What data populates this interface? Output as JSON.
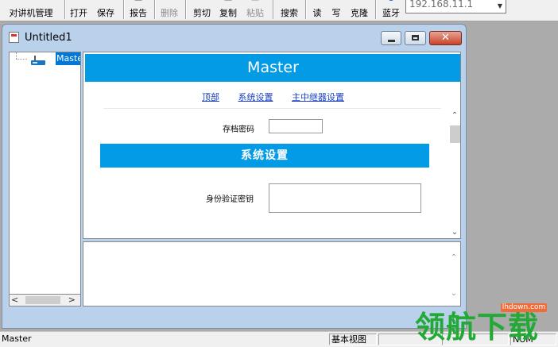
{
  "toolbar": {
    "buttons": [
      {
        "label": "对讲机管理"
      },
      {
        "label": "打开"
      },
      {
        "label": "保存"
      },
      {
        "label": "报告"
      },
      {
        "label": "删除"
      },
      {
        "label": "剪切"
      },
      {
        "label": "复制"
      },
      {
        "label": "粘贴"
      },
      {
        "label": "搜索"
      },
      {
        "label": "读"
      },
      {
        "label": "写"
      },
      {
        "label": "克隆"
      },
      {
        "label": "蓝牙"
      }
    ],
    "ip_value": "192.168.11.1"
  },
  "child_window": {
    "title": "Untitled1",
    "tree": {
      "node_label": "Master"
    },
    "web": {
      "header": "Master",
      "links": [
        "顶部",
        "系统设置",
        "主中继器设置"
      ],
      "password_label": "存档密码",
      "section_title": "系统设置",
      "auth_key_label": "身份验证密钥"
    }
  },
  "statusbar": {
    "main": "Master",
    "view": "基本视图",
    "num": "NUM"
  },
  "watermark": {
    "site": "lhdown.com",
    "brand": "领航下载"
  },
  "colors": {
    "accent": "#039be5",
    "selection": "#0078d7",
    "mdi_background": "#ababab",
    "watermark_green": "#22a936"
  }
}
